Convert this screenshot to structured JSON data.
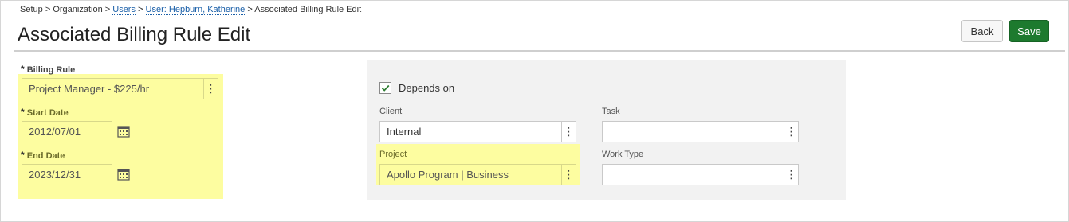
{
  "breadcrumb": {
    "setup": "Setup",
    "organization": "Organization",
    "users": "Users",
    "user": "User: Hepburn, Katherine",
    "current": "Associated Billing Rule Edit",
    "separator": ">"
  },
  "page": {
    "title": "Associated Billing Rule Edit"
  },
  "toolbar": {
    "back_label": "Back",
    "save_label": "Save"
  },
  "form": {
    "required_marker": "*",
    "billing_rule": {
      "label": "Billing Rule",
      "value": "Project Manager - $225/hr"
    },
    "start_date": {
      "label": "Start Date",
      "value": "2012/07/01"
    },
    "end_date": {
      "label": "End Date",
      "value": "2023/12/31"
    }
  },
  "depends": {
    "checkbox_label": "Depends on",
    "checked": true,
    "client": {
      "label": "Client",
      "value": "Internal"
    },
    "task": {
      "label": "Task",
      "value": ""
    },
    "project": {
      "label": "Project",
      "value": "Apollo Program | Business"
    },
    "work_type": {
      "label": "Work Type",
      "value": ""
    }
  },
  "icons": {
    "kebab": "⋮",
    "calendar": "calendar-icon",
    "check": "checkmark-icon"
  },
  "colors": {
    "highlight": "#fdfda0",
    "save_button": "#1d7a2e",
    "link": "#1a5fa8",
    "panel": "#f2f2f2"
  }
}
